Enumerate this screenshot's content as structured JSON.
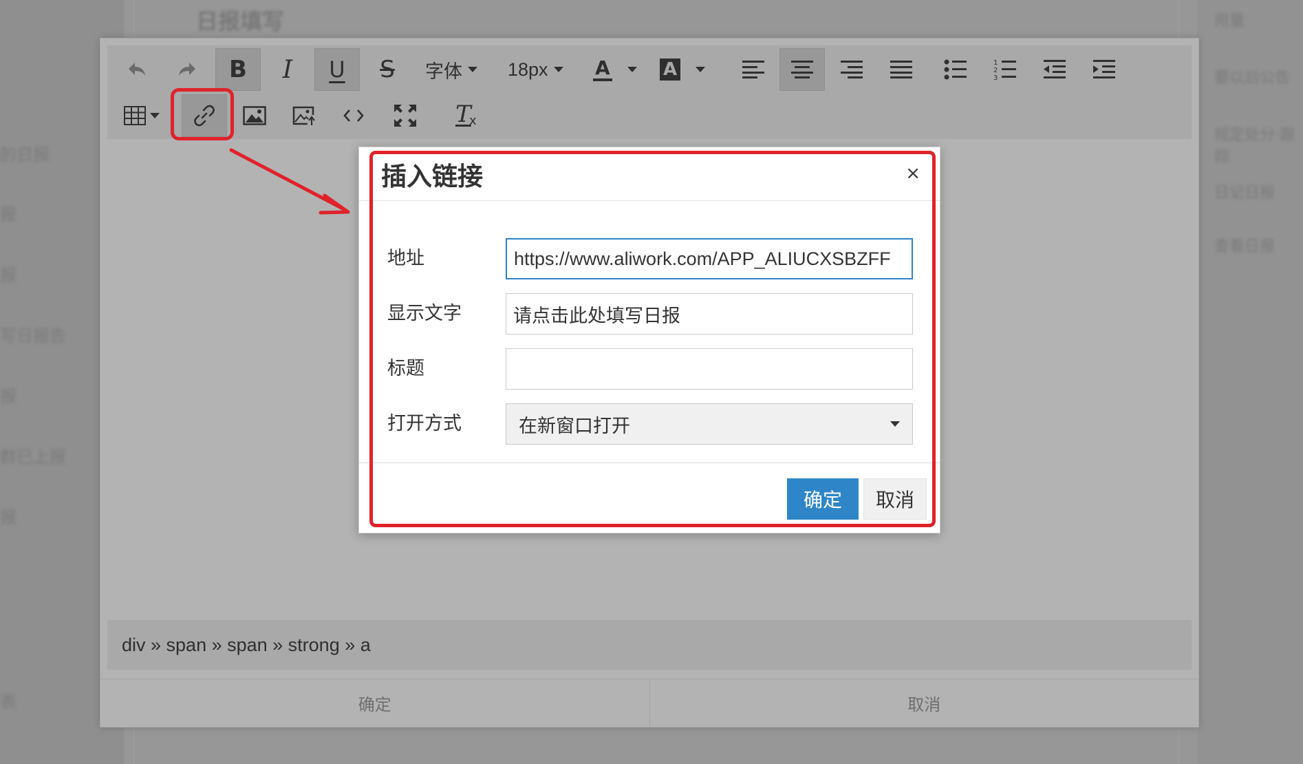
{
  "background": {
    "page_title": "日报填写",
    "left_items": [
      "的日报",
      "报",
      "报",
      "写日报告",
      "报",
      "群已上报",
      "报",
      "表"
    ],
    "right_items": [
      "用量",
      "要以后公告",
      "规定处分·跟踪",
      "日记日报",
      "查看日报"
    ]
  },
  "toolbar": {
    "font_label": "字体",
    "size_label": "18px",
    "font_color_letter": "A",
    "bg_color_letter": "A",
    "bold_letter": "B",
    "italic_letter": "I",
    "underline_letter": "U",
    "strike_letter": "S",
    "clear_format_letter": "T",
    "clear_format_sub": "x"
  },
  "status_bar": {
    "path": "div » span » span » strong » a"
  },
  "editor_footer": {
    "ok_label": "确定",
    "cancel_label": "取消"
  },
  "dialog": {
    "title": "插入链接",
    "close_symbol": "×",
    "fields": {
      "url_label": "地址",
      "url_value": "https://www.aliwork.com/APP_ALIUCXSBZFF",
      "text_label": "显示文字",
      "text_value": "请点击此处填写日报",
      "title_label": "标题",
      "title_value": "",
      "target_label": "打开方式",
      "target_value": "在新窗口打开"
    },
    "ok_label": "确定",
    "cancel_label": "取消"
  },
  "colors": {
    "highlight": "#e0222b",
    "primary_button": "#2e86c8",
    "focus_border": "#2d82c6"
  }
}
